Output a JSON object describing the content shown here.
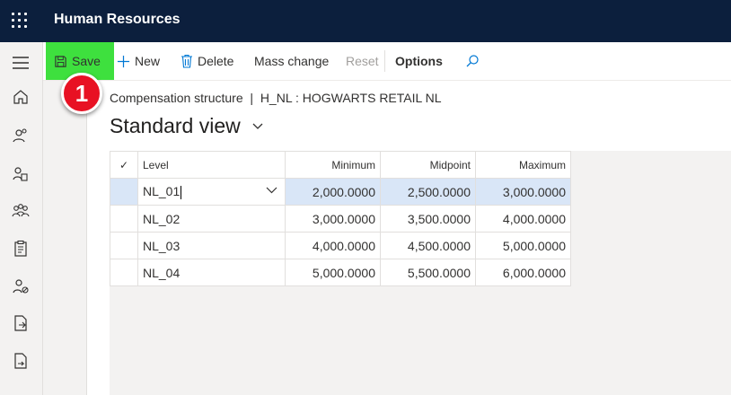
{
  "app": {
    "title": "Human Resources"
  },
  "toolbar": {
    "save": "Save",
    "new": "New",
    "delete": "Delete",
    "mass_change": "Mass change",
    "reset": "Reset",
    "options": "Options",
    "save_highlight_color": "#3ee03e"
  },
  "callout": {
    "number": "1",
    "color": "#e81123"
  },
  "breadcrumb": "Compensation structure  |  H_NL : HOGWARTS RETAIL NL",
  "view": {
    "title": "Standard view"
  },
  "grid": {
    "headers": {
      "check": "✓",
      "level": "Level",
      "minimum": "Minimum",
      "midpoint": "Midpoint",
      "maximum": "Maximum"
    },
    "rows": [
      {
        "level": "NL_01",
        "minimum": "2,000.0000",
        "midpoint": "2,500.0000",
        "maximum": "3,000.0000",
        "selected": true
      },
      {
        "level": "NL_02",
        "minimum": "3,000.0000",
        "midpoint": "3,500.0000",
        "maximum": "4,000.0000"
      },
      {
        "level": "NL_03",
        "minimum": "4,000.0000",
        "midpoint": "4,500.0000",
        "maximum": "5,000.0000"
      },
      {
        "level": "NL_04",
        "minimum": "5,000.0000",
        "midpoint": "5,500.0000",
        "maximum": "6,000.0000"
      }
    ]
  },
  "nav_icons": [
    "home-icon",
    "people-icon",
    "person-document-icon",
    "team-icon",
    "clipboard-icon",
    "person-block-icon",
    "document-export-icon",
    "document-forward-icon"
  ]
}
